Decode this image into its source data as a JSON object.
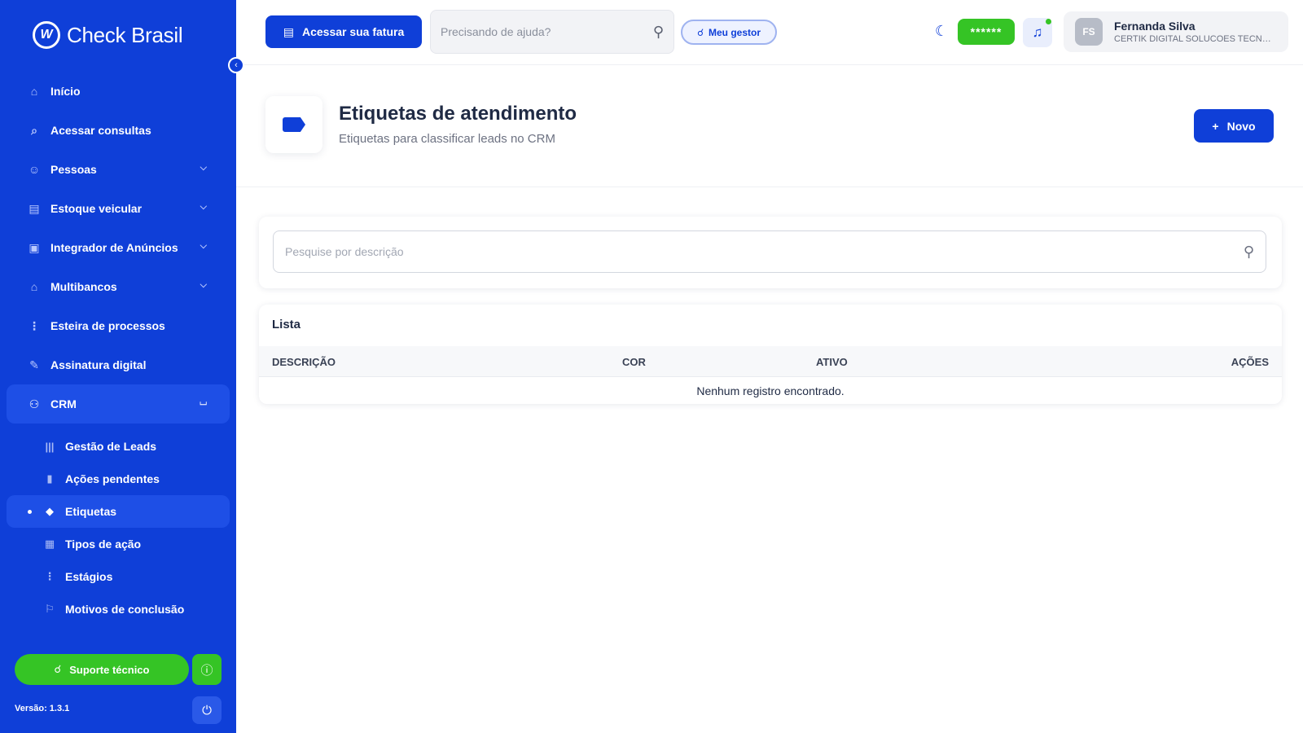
{
  "brand": {
    "name": "Check Brasil",
    "logo_glyph": "W"
  },
  "sidebar": {
    "items": [
      {
        "label": "Início",
        "icon": "home-icon",
        "glyph": "⌂",
        "has_chevron": false
      },
      {
        "label": "Acessar consultas",
        "icon": "search-icon",
        "glyph": "⌕",
        "has_chevron": false
      },
      {
        "label": "Pessoas",
        "icon": "people-icon",
        "glyph": "☺",
        "has_chevron": true
      },
      {
        "label": "Estoque veicular",
        "icon": "building-icon",
        "glyph": "▤",
        "has_chevron": true
      },
      {
        "label": "Integrador de Anúncios",
        "icon": "ads-icon",
        "glyph": "▣",
        "has_chevron": true
      },
      {
        "label": "Multibancos",
        "icon": "bank-icon",
        "glyph": "⌂",
        "has_chevron": true
      },
      {
        "label": "Esteira de processos",
        "icon": "flow-icon",
        "glyph": "⋮",
        "has_chevron": false
      },
      {
        "label": "Assinatura digital",
        "icon": "signature-icon",
        "glyph": "✎",
        "has_chevron": false
      },
      {
        "label": "CRM",
        "icon": "group-icon",
        "glyph": "⚇",
        "has_chevron": true,
        "expanded": true
      }
    ],
    "crm_subitems": [
      {
        "label": "Gestão de Leads",
        "icon": "columns-icon",
        "glyph": "|||"
      },
      {
        "label": "Ações pendentes",
        "icon": "clipboard-icon",
        "glyph": "▮"
      },
      {
        "label": "Etiquetas",
        "icon": "tag-icon",
        "glyph": "◆",
        "active": true
      },
      {
        "label": "Tipos de ação",
        "icon": "list-icon",
        "glyph": "▦"
      },
      {
        "label": "Estágios",
        "icon": "stages-icon",
        "glyph": "⋮"
      },
      {
        "label": "Motivos de conclusão",
        "icon": "flag-icon",
        "glyph": "⚐"
      }
    ],
    "support_label": "Suporte técnico",
    "version": "Versão: 1.3.1"
  },
  "topbar": {
    "invoice_label": "Acessar sua fatura",
    "help_placeholder": "Precisando de ajuda?",
    "manager_label": "Meu gestor",
    "password_mask": "******",
    "user": {
      "initials": "FS",
      "name": "Fernanda Silva",
      "company": "CERTIK DIGITAL SOLUCOES TECNOLOGICAS LTDA"
    }
  },
  "page": {
    "title": "Etiquetas de atendimento",
    "subtitle": "Etiquetas para classificar leads no CRM",
    "new_label": "Novo",
    "search_placeholder": "Pesquise por descrição"
  },
  "list": {
    "title": "Lista",
    "columns": [
      "DESCRIÇÃO",
      "COR",
      "ATIVO",
      "AÇÕES"
    ],
    "empty_message": "Nenhum registro encontrado."
  },
  "colors": {
    "brand_blue": "#0f3fd8",
    "accent_green": "#35c425"
  }
}
